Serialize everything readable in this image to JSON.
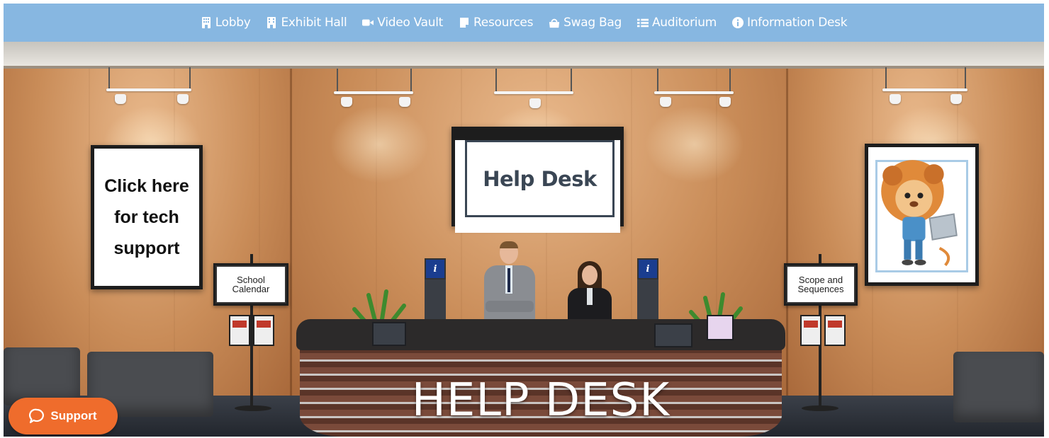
{
  "nav": {
    "items": [
      {
        "label": "Lobby",
        "icon": "building-icon"
      },
      {
        "label": "Exhibit Hall",
        "icon": "building-icon"
      },
      {
        "label": "Video Vault",
        "icon": "video-camera-icon"
      },
      {
        "label": "Resources",
        "icon": "file-icon"
      },
      {
        "label": "Swag Bag",
        "icon": "shopping-bag-icon"
      },
      {
        "label": "Auditorium",
        "icon": "list-icon"
      },
      {
        "label": "Information Desk",
        "icon": "info-circle-icon"
      }
    ],
    "background": "#87b7e1"
  },
  "posters": {
    "tech_support": "Click here for tech support",
    "help_desk_sign": "Help Desk"
  },
  "signs": {
    "school_calendar": "School Calendar",
    "scope_and_sequences": "Scope and Sequences"
  },
  "kiosk_icon": "i",
  "desk_title": "HELP DESK",
  "support_button": {
    "label": "Support",
    "icon": "chat-bubble-icon",
    "color": "#ef6c2c"
  }
}
